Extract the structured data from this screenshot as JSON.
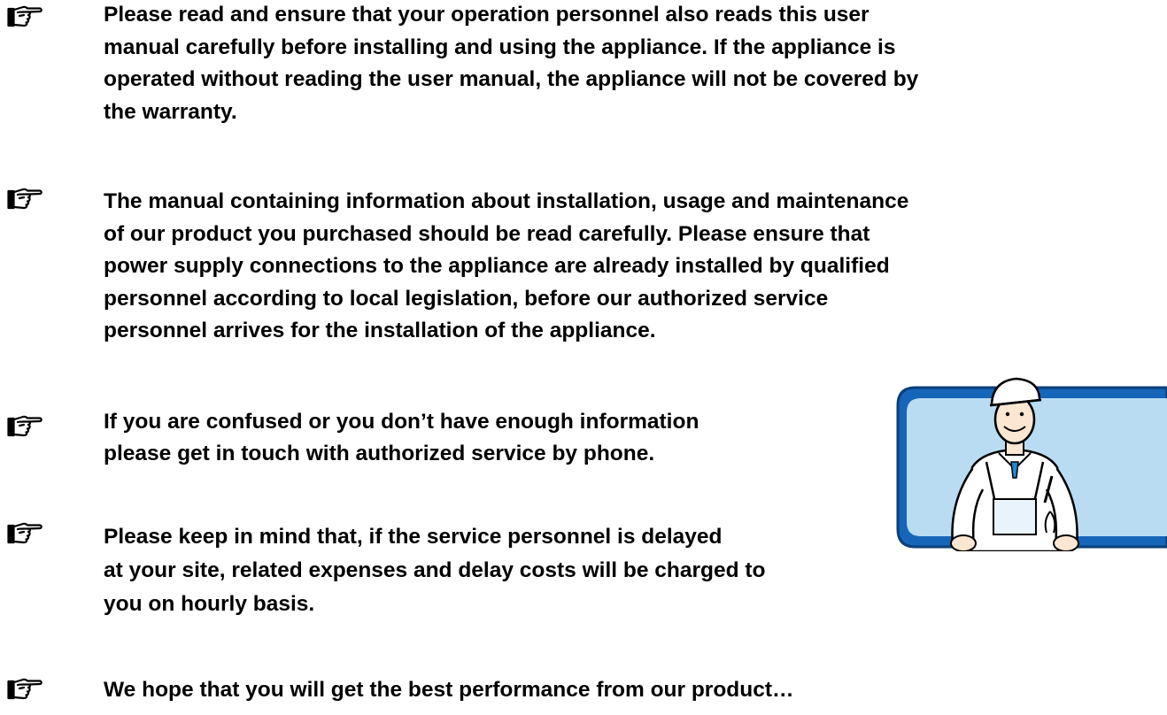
{
  "notes": [
    {
      "icon": "pointing-hand-icon",
      "text": "Please read and ensure that your operation personnel also reads this user\nmanual carefully before installing and using the appliance. If the appliance is\noperated without reading the user manual, the appliance will not be covered by\nthe warranty."
    },
    {
      "icon": "pointing-hand-icon",
      "text": "The manual containing information about installation, usage and maintenance\nof our product you purchased should be read carefully. Please ensure that\npower supply connections to the appliance are already installed by qualified\npersonnel according to local legislation, before our authorized service\npersonnel arrives for the installation of the appliance."
    },
    {
      "icon": "pointing-hand-icon",
      "text": "If you are confused or you don’t have enough information\nplease get in touch with authorized service by phone."
    },
    {
      "icon": "pointing-hand-icon",
      "text": "Please keep in mind that, if the service personnel is delayed\nat  your site, related expenses and delay costs will be charged to\nyou on hourly basis."
    },
    {
      "icon": "pointing-hand-icon",
      "text": "We hope that you will get the best performance from our product…"
    }
  ],
  "illustration": {
    "icon": "service-technician-icon",
    "colors": {
      "frame": "#1565b8",
      "background": "#b9dcf2",
      "uniform": "#ffffff"
    }
  }
}
